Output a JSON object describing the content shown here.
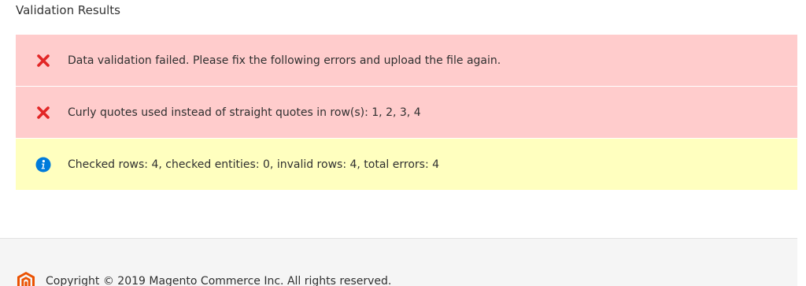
{
  "page": {
    "section_title": "Validation Results"
  },
  "messages": [
    {
      "type": "error",
      "icon": "error-x-icon",
      "text": "Data validation failed. Please fix the following errors and upload the file again."
    },
    {
      "type": "error",
      "icon": "error-x-icon",
      "text": "Curly quotes used instead of straight quotes in row(s): 1, 2, 3, 4"
    },
    {
      "type": "info",
      "icon": "info-icon",
      "text": "Checked rows: 4, checked entities: 0, invalid rows: 4, total errors: 4"
    }
  ],
  "footer": {
    "copyright": "Copyright © 2019 Magento Commerce Inc. All rights reserved.",
    "logo_icon": "magento-logo-icon"
  },
  "colors": {
    "error_bg": "#ffcccc",
    "info_bg": "#ffffbf",
    "error_icon": "#e22626",
    "info_icon": "#007bdb",
    "logo": "#eb5202"
  }
}
